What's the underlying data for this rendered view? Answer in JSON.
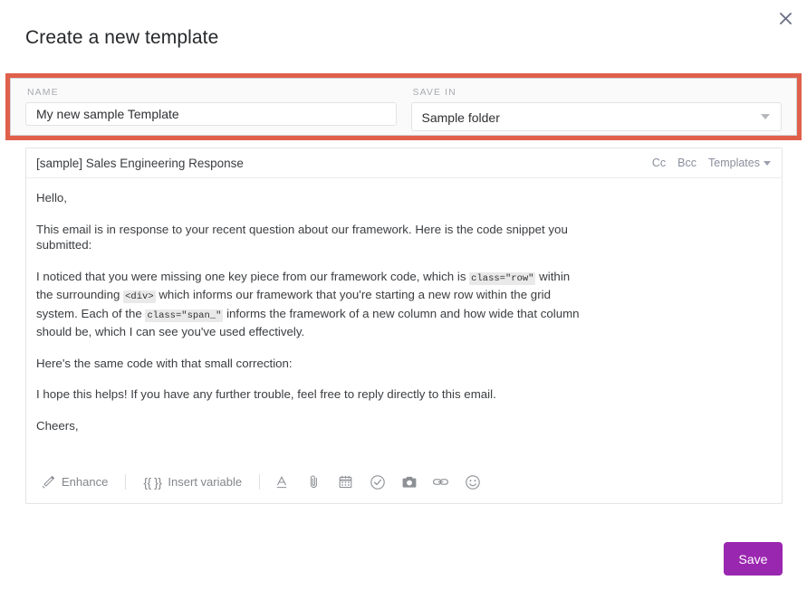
{
  "dialog": {
    "title": "Create a new template",
    "close_icon": "close-icon",
    "colors": {
      "accent_purple": "#9a27b0",
      "highlight_red": "#e0604b",
      "text": "#3b3d40",
      "muted": "#8b8e9c"
    }
  },
  "meta": {
    "name": {
      "label": "NAME",
      "value": "My new sample Template",
      "placeholder": "Name"
    },
    "save_in": {
      "label": "SAVE IN",
      "value": "Sample folder",
      "caret_icon": "chevron-down-icon",
      "options": [
        "Sample folder"
      ]
    }
  },
  "composer": {
    "subject": "[sample] Sales Engineering Response",
    "actions": [
      {
        "label": "Cc",
        "name": "cc-button"
      },
      {
        "label": "Bcc",
        "name": "bcc-button"
      },
      {
        "label": "Templates",
        "name": "templates-button"
      }
    ],
    "body": {
      "greeting": "Hello,",
      "p1": "This email is in response to your recent question about our framework. Here is the code snippet you submitted:",
      "p2_a": "I noticed that you were missing one key piece from our framework code, which is ",
      "p2_code1": "class=\"row\"",
      "p2_b": " within the surrounding ",
      "p2_code2": "<div>",
      "p2_c": "  which informs our framework that you're starting a new row within the grid system. Each of the ",
      "p2_code3": "class=\"span_\"",
      "p2_d": " informs the framework of a new column and how wide that column should be, which I can see you've used effectively.",
      "p3": "Here's the same code with that small correction:",
      "p4": "I hope this helps! If you have any further trouble, feel free to reply directly to this email.",
      "p5": "Cheers,"
    },
    "toolbar": {
      "enhance_label": "Enhance",
      "enhance_icon": "magic-wand-icon",
      "insert_variable_label": "Insert variable",
      "insert_variable_braces": "{{ }}",
      "icons": [
        {
          "name": "format-text-icon",
          "glyph": "A"
        },
        {
          "name": "attachment-paperclip-icon",
          "glyph": "paperclip"
        },
        {
          "name": "calendar-icon",
          "glyph": "calendar"
        },
        {
          "name": "task-check-circle-icon",
          "glyph": "check-circle"
        },
        {
          "name": "camera-icon",
          "glyph": "camera"
        },
        {
          "name": "link-icon",
          "glyph": "link"
        },
        {
          "name": "emoji-smiley-icon",
          "glyph": "smiley"
        }
      ]
    }
  },
  "footer": {
    "save_label": "Save"
  }
}
